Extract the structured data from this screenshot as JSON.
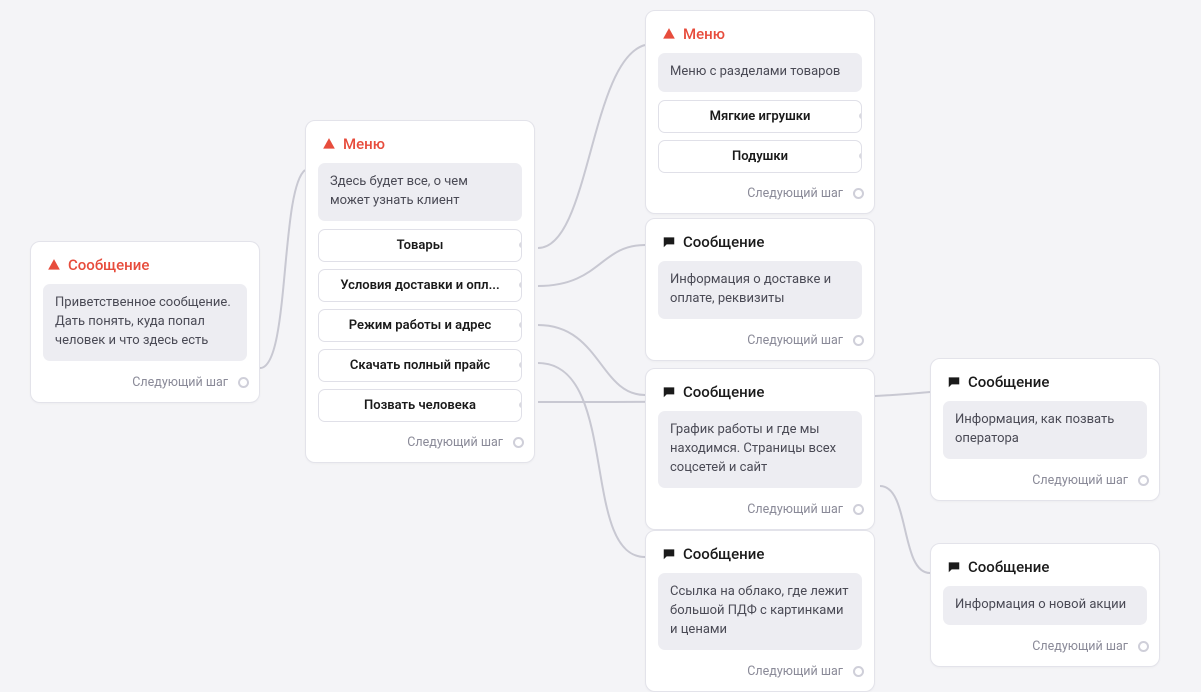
{
  "labels": {
    "next_step": "Следующий шаг",
    "menu": "Меню",
    "message": "Сообщение"
  },
  "nodes": {
    "n1": {
      "title_key": "message",
      "body": "Приветственное сообщение. Дать понять, куда попал человек и что здесь есть"
    },
    "n2": {
      "title_key": "menu",
      "body": "Здесь будет все, о чем может узнать клиент",
      "options": [
        "Товары",
        "Условия доставки и опл...",
        "Режим работы и адрес",
        "Скачать полный прайс",
        "Позвать человека"
      ]
    },
    "n3": {
      "title_key": "menu",
      "body": "Меню с разделами товаров",
      "options": [
        "Мягкие игрушки",
        "Подушки"
      ]
    },
    "n4": {
      "title_key": "message",
      "body": "Информация о доставке и оплате, реквизиты"
    },
    "n5": {
      "title_key": "message",
      "body": "График работы и где мы находимся. Страницы всех соцсетей и сайт"
    },
    "n6": {
      "title_key": "message",
      "body": "Ссылка на облако, где лежит большой ПДФ с картинками и ценами"
    },
    "n7": {
      "title_key": "message",
      "body": "Информация, как позвать оператора"
    },
    "n8": {
      "title_key": "message",
      "body": "Информация о новой акции"
    }
  }
}
